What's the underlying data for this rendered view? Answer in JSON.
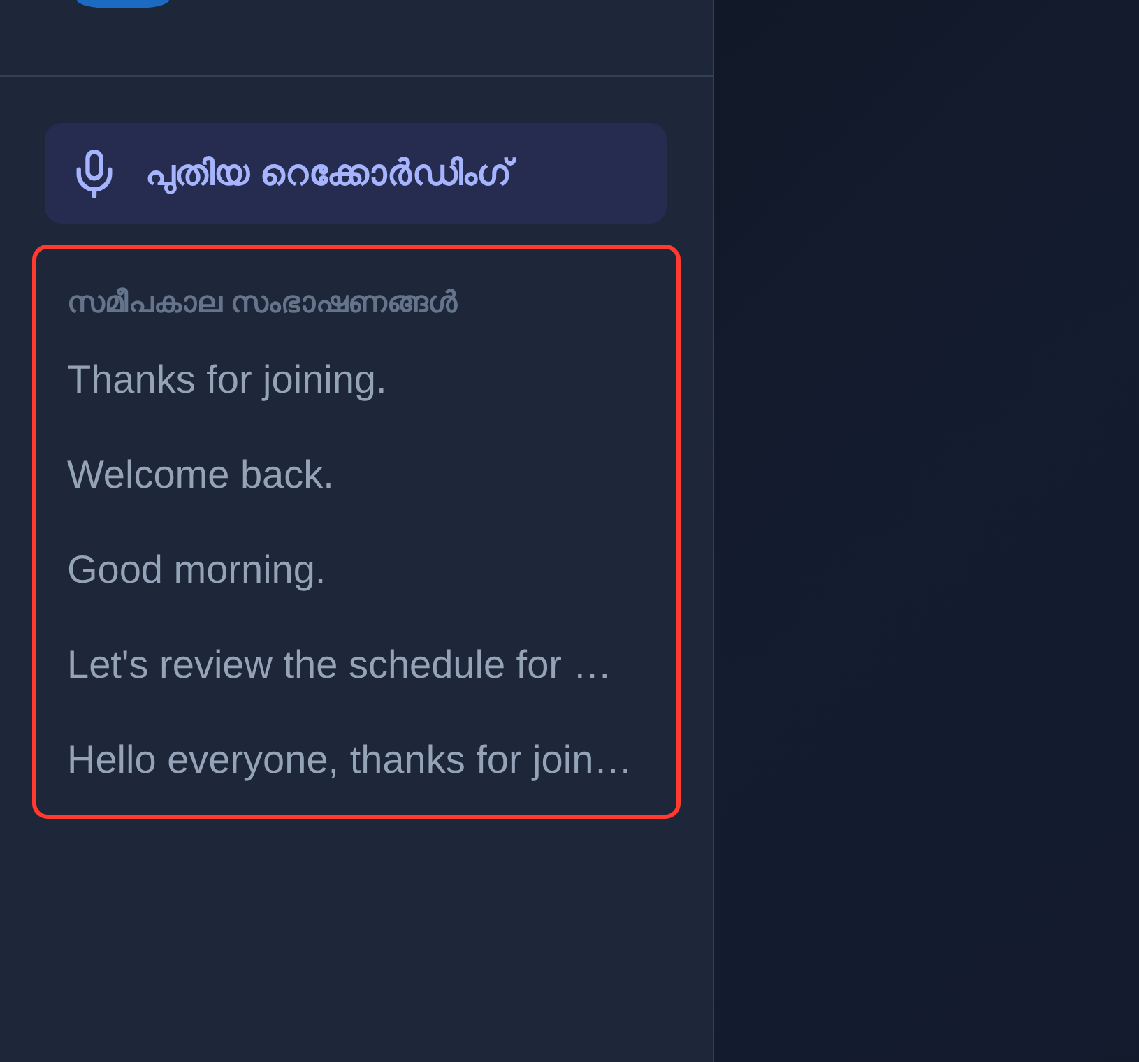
{
  "sidebar": {
    "new_recording_button": {
      "label": "പുതിയ റെക്കോർഡിംഗ്"
    },
    "recent": {
      "highlighted": true,
      "heading": "സമീപകാല സംഭാഷണങ്ങൾ",
      "items": [
        {
          "label": "Thanks for joining."
        },
        {
          "label": "Welcome back."
        },
        {
          "label": "Good morning."
        },
        {
          "label": "Let's review the schedule for …"
        },
        {
          "label": "Hello everyone, thanks for join…"
        }
      ]
    }
  }
}
